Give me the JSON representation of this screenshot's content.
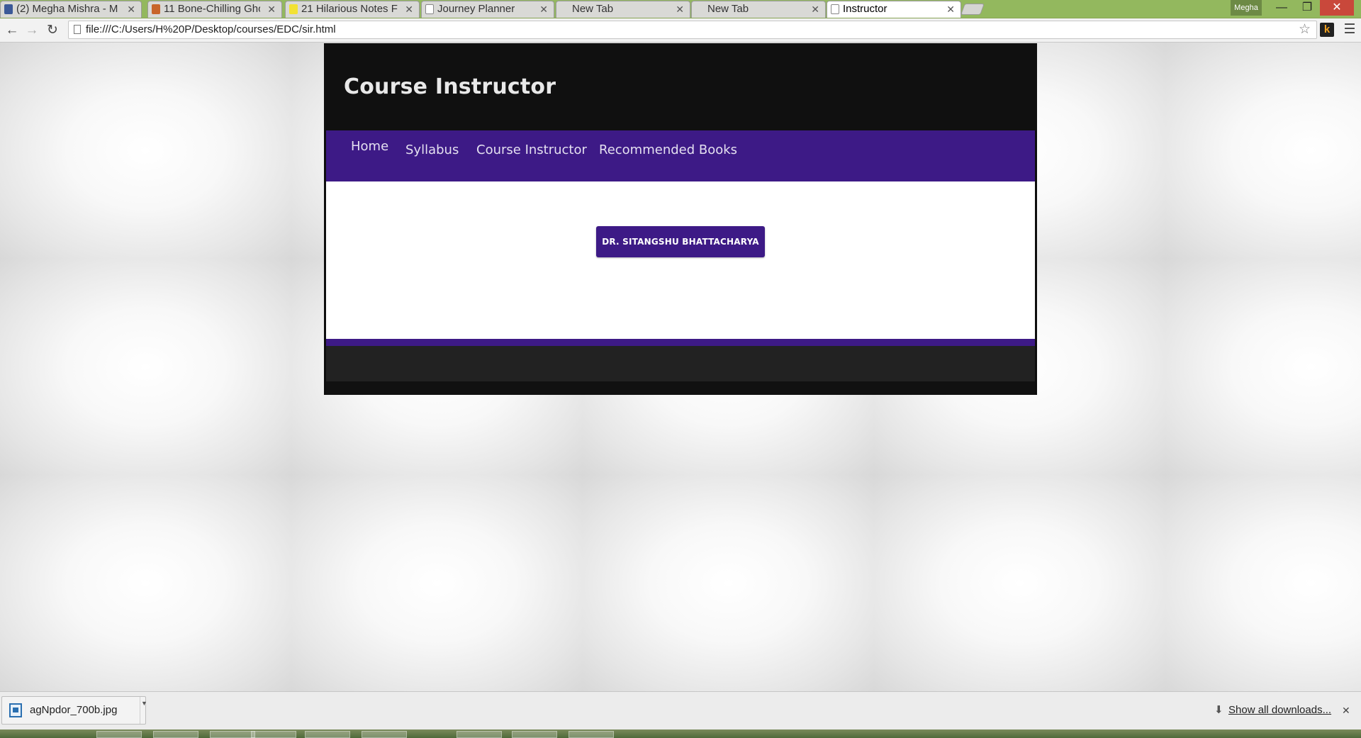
{
  "browser": {
    "tabs": [
      {
        "title": "(2) Megha Mishra - M",
        "icon": "facebook-icon",
        "icon_color": "#3b5998",
        "active": false
      },
      {
        "title": "11 Bone-Chilling Gho",
        "icon": "buzzfeed-icon",
        "icon_color": "#c8652a",
        "active": false
      },
      {
        "title": "21 Hilarious Notes Fr",
        "icon": "yellow-note-icon",
        "icon_color": "#f2e233",
        "active": false
      },
      {
        "title": "Journey Planner",
        "icon": "page-icon",
        "icon_color": "#ffffff",
        "active": false
      },
      {
        "title": "New Tab",
        "icon": "",
        "icon_color": "",
        "active": false
      },
      {
        "title": "New Tab",
        "icon": "",
        "icon_color": "",
        "active": false
      },
      {
        "title": "Instructor",
        "icon": "page-icon",
        "icon_color": "#ffffff",
        "active": true
      }
    ],
    "profile_name": "Megha",
    "url": "file:///C:/Users/H%20P/Desktop/courses/EDC/sir.html"
  },
  "site": {
    "title": "Course Instructor",
    "nav": [
      {
        "label": "Home"
      },
      {
        "label": "Syllabus"
      },
      {
        "label": "Course Instructor"
      },
      {
        "label": "Recommended Books"
      }
    ],
    "instructor_button": "DR. SITANGSHU BHATTACHARYA",
    "accent_color": "#3d1a86"
  },
  "downloads": {
    "filename": "agNpdor_700b.jpg",
    "show_all": "Show all downloads..."
  }
}
